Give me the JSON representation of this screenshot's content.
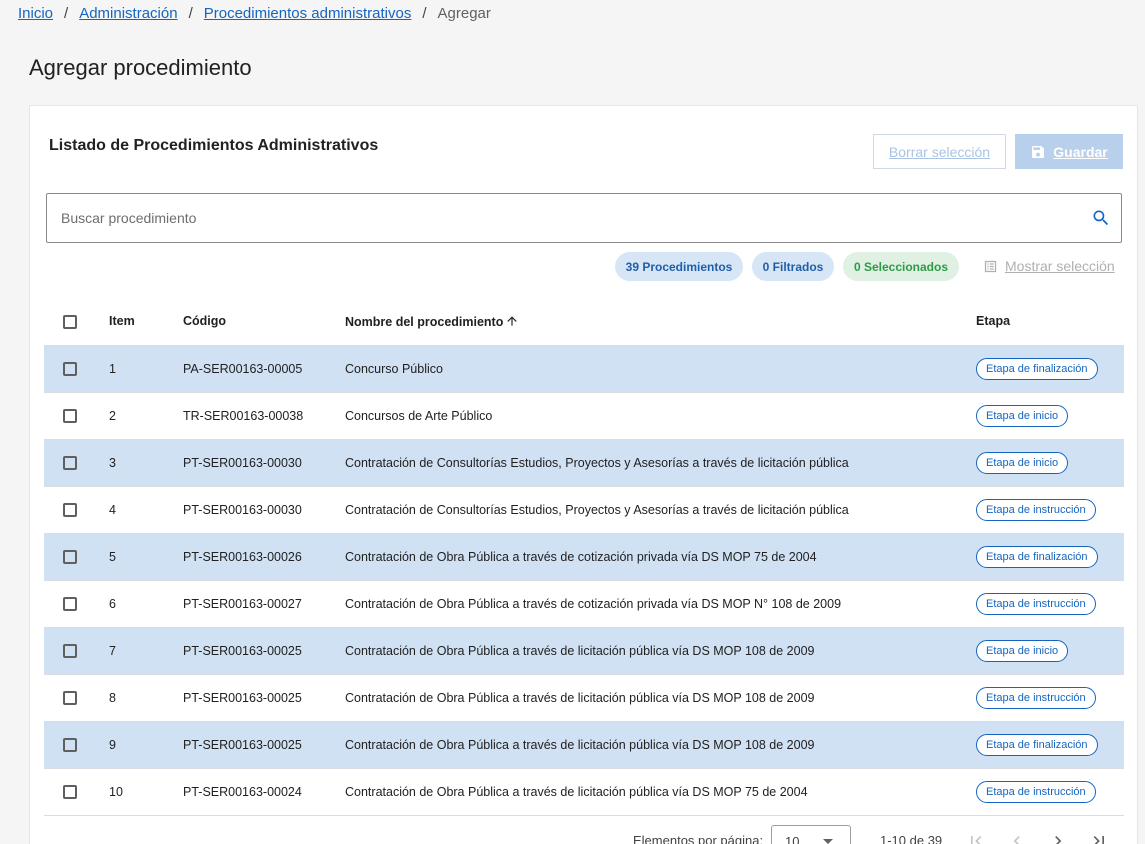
{
  "breadcrumb": {
    "items": [
      "Inicio",
      "Administración",
      "Procedimientos administrativos"
    ],
    "current": "Agregar",
    "separator": "/"
  },
  "page": {
    "title": "Agregar procedimiento"
  },
  "card": {
    "title": "Listado de Procedimientos Administrativos",
    "clear_label": "Borrar selección",
    "save_label": "Guardar",
    "save_icon": "floppy-disk-icon"
  },
  "search": {
    "placeholder": "Buscar procedimiento",
    "value": "",
    "icon": "search-icon"
  },
  "chips": {
    "total": "39 Procedimientos",
    "filtered": "0 Filtrados",
    "selected": "0 Seleccionados"
  },
  "show_selection": {
    "label": "Mostrar selección",
    "icon": "list-icon"
  },
  "table": {
    "headers": {
      "item": "Item",
      "code": "Código",
      "name": "Nombre del procedimiento",
      "stage": "Etapa"
    },
    "sort": {
      "column": "name",
      "direction": "ascending",
      "icon": "arrow-up-icon"
    },
    "rows": [
      {
        "item": "1",
        "code": "PA-SER00163-00005",
        "name": "Concurso Público",
        "stage": "Etapa de finalización"
      },
      {
        "item": "2",
        "code": "TR-SER00163-00038",
        "name": "Concursos de Arte Público",
        "stage": "Etapa de inicio"
      },
      {
        "item": "3",
        "code": "PT-SER00163-00030",
        "name": "Contratación de Consultorías Estudios, Proyectos y Asesorías a través de licitación pública",
        "stage": "Etapa de inicio"
      },
      {
        "item": "4",
        "code": "PT-SER00163-00030",
        "name": "Contratación de Consultorías Estudios, Proyectos y Asesorías a través de licitación pública",
        "stage": "Etapa de instrucción"
      },
      {
        "item": "5",
        "code": "PT-SER00163-00026",
        "name": "Contratación de Obra Pública a través de cotización privada vía DS MOP 75 de 2004",
        "stage": "Etapa de finalización"
      },
      {
        "item": "6",
        "code": "PT-SER00163-00027",
        "name": "Contratación de Obra Pública a través de cotización privada vía DS MOP N° 108 de 2009",
        "stage": "Etapa de instrucción"
      },
      {
        "item": "7",
        "code": "PT-SER00163-00025",
        "name": "Contratación de Obra Pública a través de licitación pública vía DS MOP 108 de 2009",
        "stage": "Etapa de inicio"
      },
      {
        "item": "8",
        "code": "PT-SER00163-00025",
        "name": "Contratación de Obra Pública a través de licitación pública vía DS MOP 108 de 2009",
        "stage": "Etapa de instrucción"
      },
      {
        "item": "9",
        "code": "PT-SER00163-00025",
        "name": "Contratación de Obra Pública a través de licitación pública vía DS MOP 108 de 2009",
        "stage": "Etapa de finalización"
      },
      {
        "item": "10",
        "code": "PT-SER00163-00024",
        "name": "Contratación de Obra Pública a través de licitación pública vía DS MOP 75 de 2004",
        "stage": "Etapa de instrucción"
      }
    ]
  },
  "paginator": {
    "label": "Elementos por página:",
    "page_size": "10",
    "range": "1-10 de 39"
  },
  "colors": {
    "primary": "#1565c0",
    "row_highlight": "#d0e1f4",
    "chip_blue_bg": "#d7e6f6",
    "chip_green_bg": "#e0f1e3",
    "chip_green_text": "#2e9a48",
    "save_button_bg": "#b8d0ec"
  }
}
